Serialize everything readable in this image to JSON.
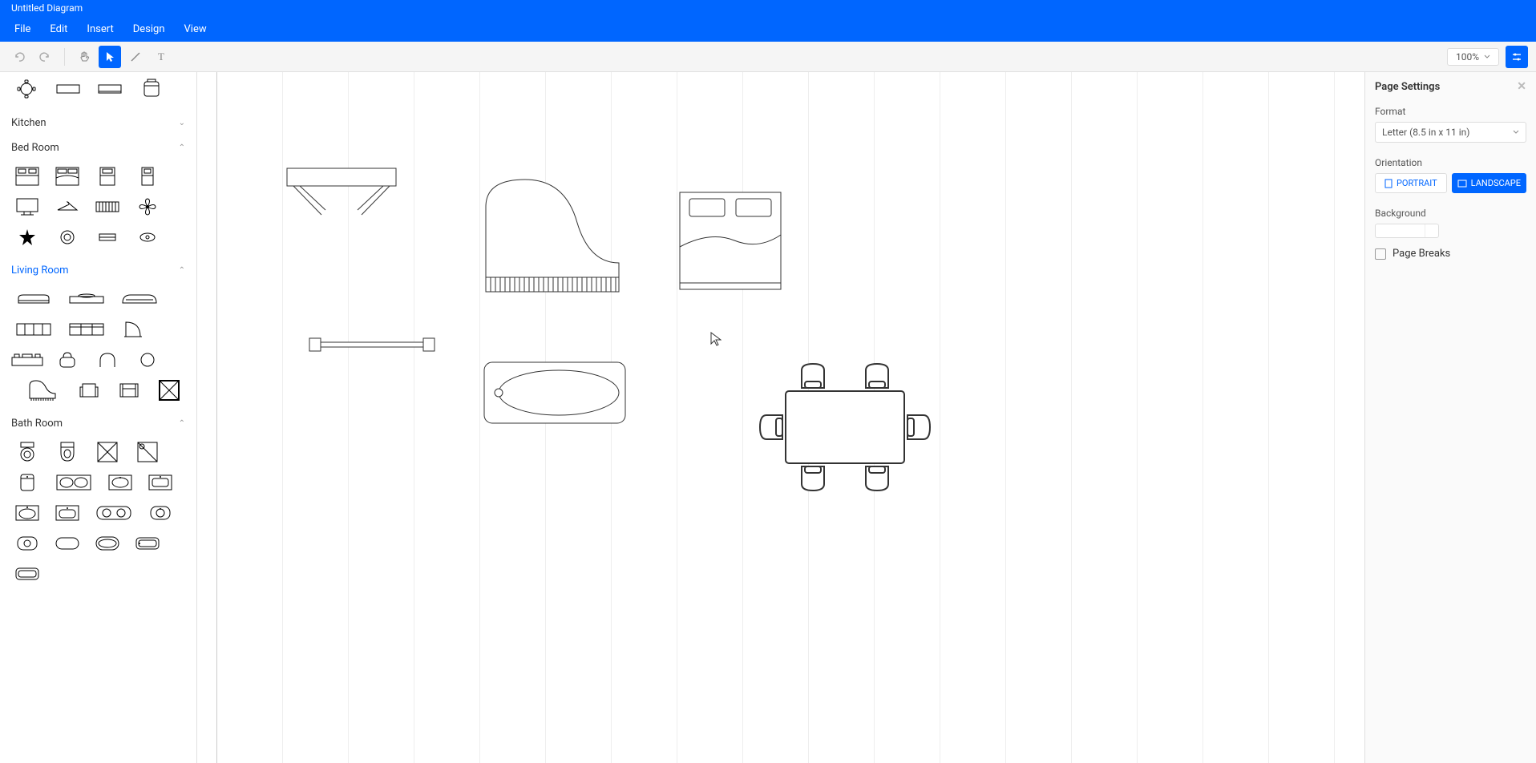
{
  "title": "Untitled Diagram",
  "menu": {
    "file": "File",
    "edit": "Edit",
    "insert": "Insert",
    "design": "Design",
    "view": "View"
  },
  "toolbar": {
    "zoom": "100%"
  },
  "sidebar": {
    "categories": {
      "kitchen": "Kitchen",
      "bedroom": "Bed Room",
      "livingroom": "Living Room",
      "bathroom": "Bath Room"
    }
  },
  "panel": {
    "title": "Page Settings",
    "format_label": "Format",
    "format_value": "Letter (8.5 in x 11 in)",
    "orientation_label": "Orientation",
    "portrait": "PORTRAIT",
    "landscape": "LANDSCAPE",
    "background_label": "Background",
    "page_breaks": "Page Breaks"
  }
}
